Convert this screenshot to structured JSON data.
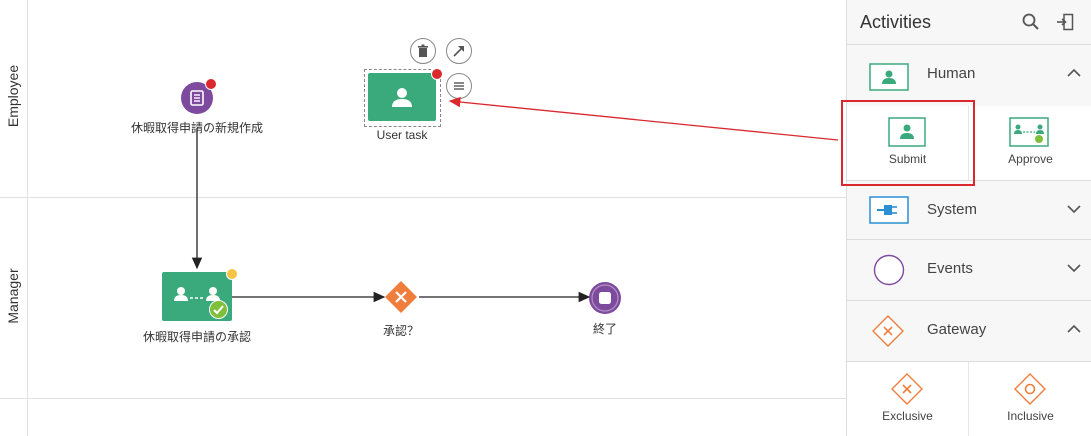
{
  "lanes": {
    "employee": "Employee",
    "manager": "Manager"
  },
  "nodes": {
    "start_label": "休暇取得申請の新規作成",
    "user_task_label": "User task",
    "approve_task_label": "休暇取得申請の承認",
    "gateway_label": "承認？",
    "end_label": "終了"
  },
  "panel": {
    "title": "Activities",
    "categories": {
      "human": "Human",
      "system": "System",
      "events": "Events",
      "gateway": "Gateway"
    },
    "human_tiles": {
      "submit": "Submit",
      "approve": "Approve"
    },
    "gateway_tiles": {
      "exclusive": "Exclusive",
      "inclusive": "Inclusive"
    }
  },
  "colors": {
    "task_green": "#3aaa7c",
    "event_purple": "#7d4a9e",
    "gateway_orange": "#ef7d3c",
    "error_red": "#d9282e",
    "warn_yellow": "#f6c344",
    "system_blue": "#2a8fd3"
  }
}
